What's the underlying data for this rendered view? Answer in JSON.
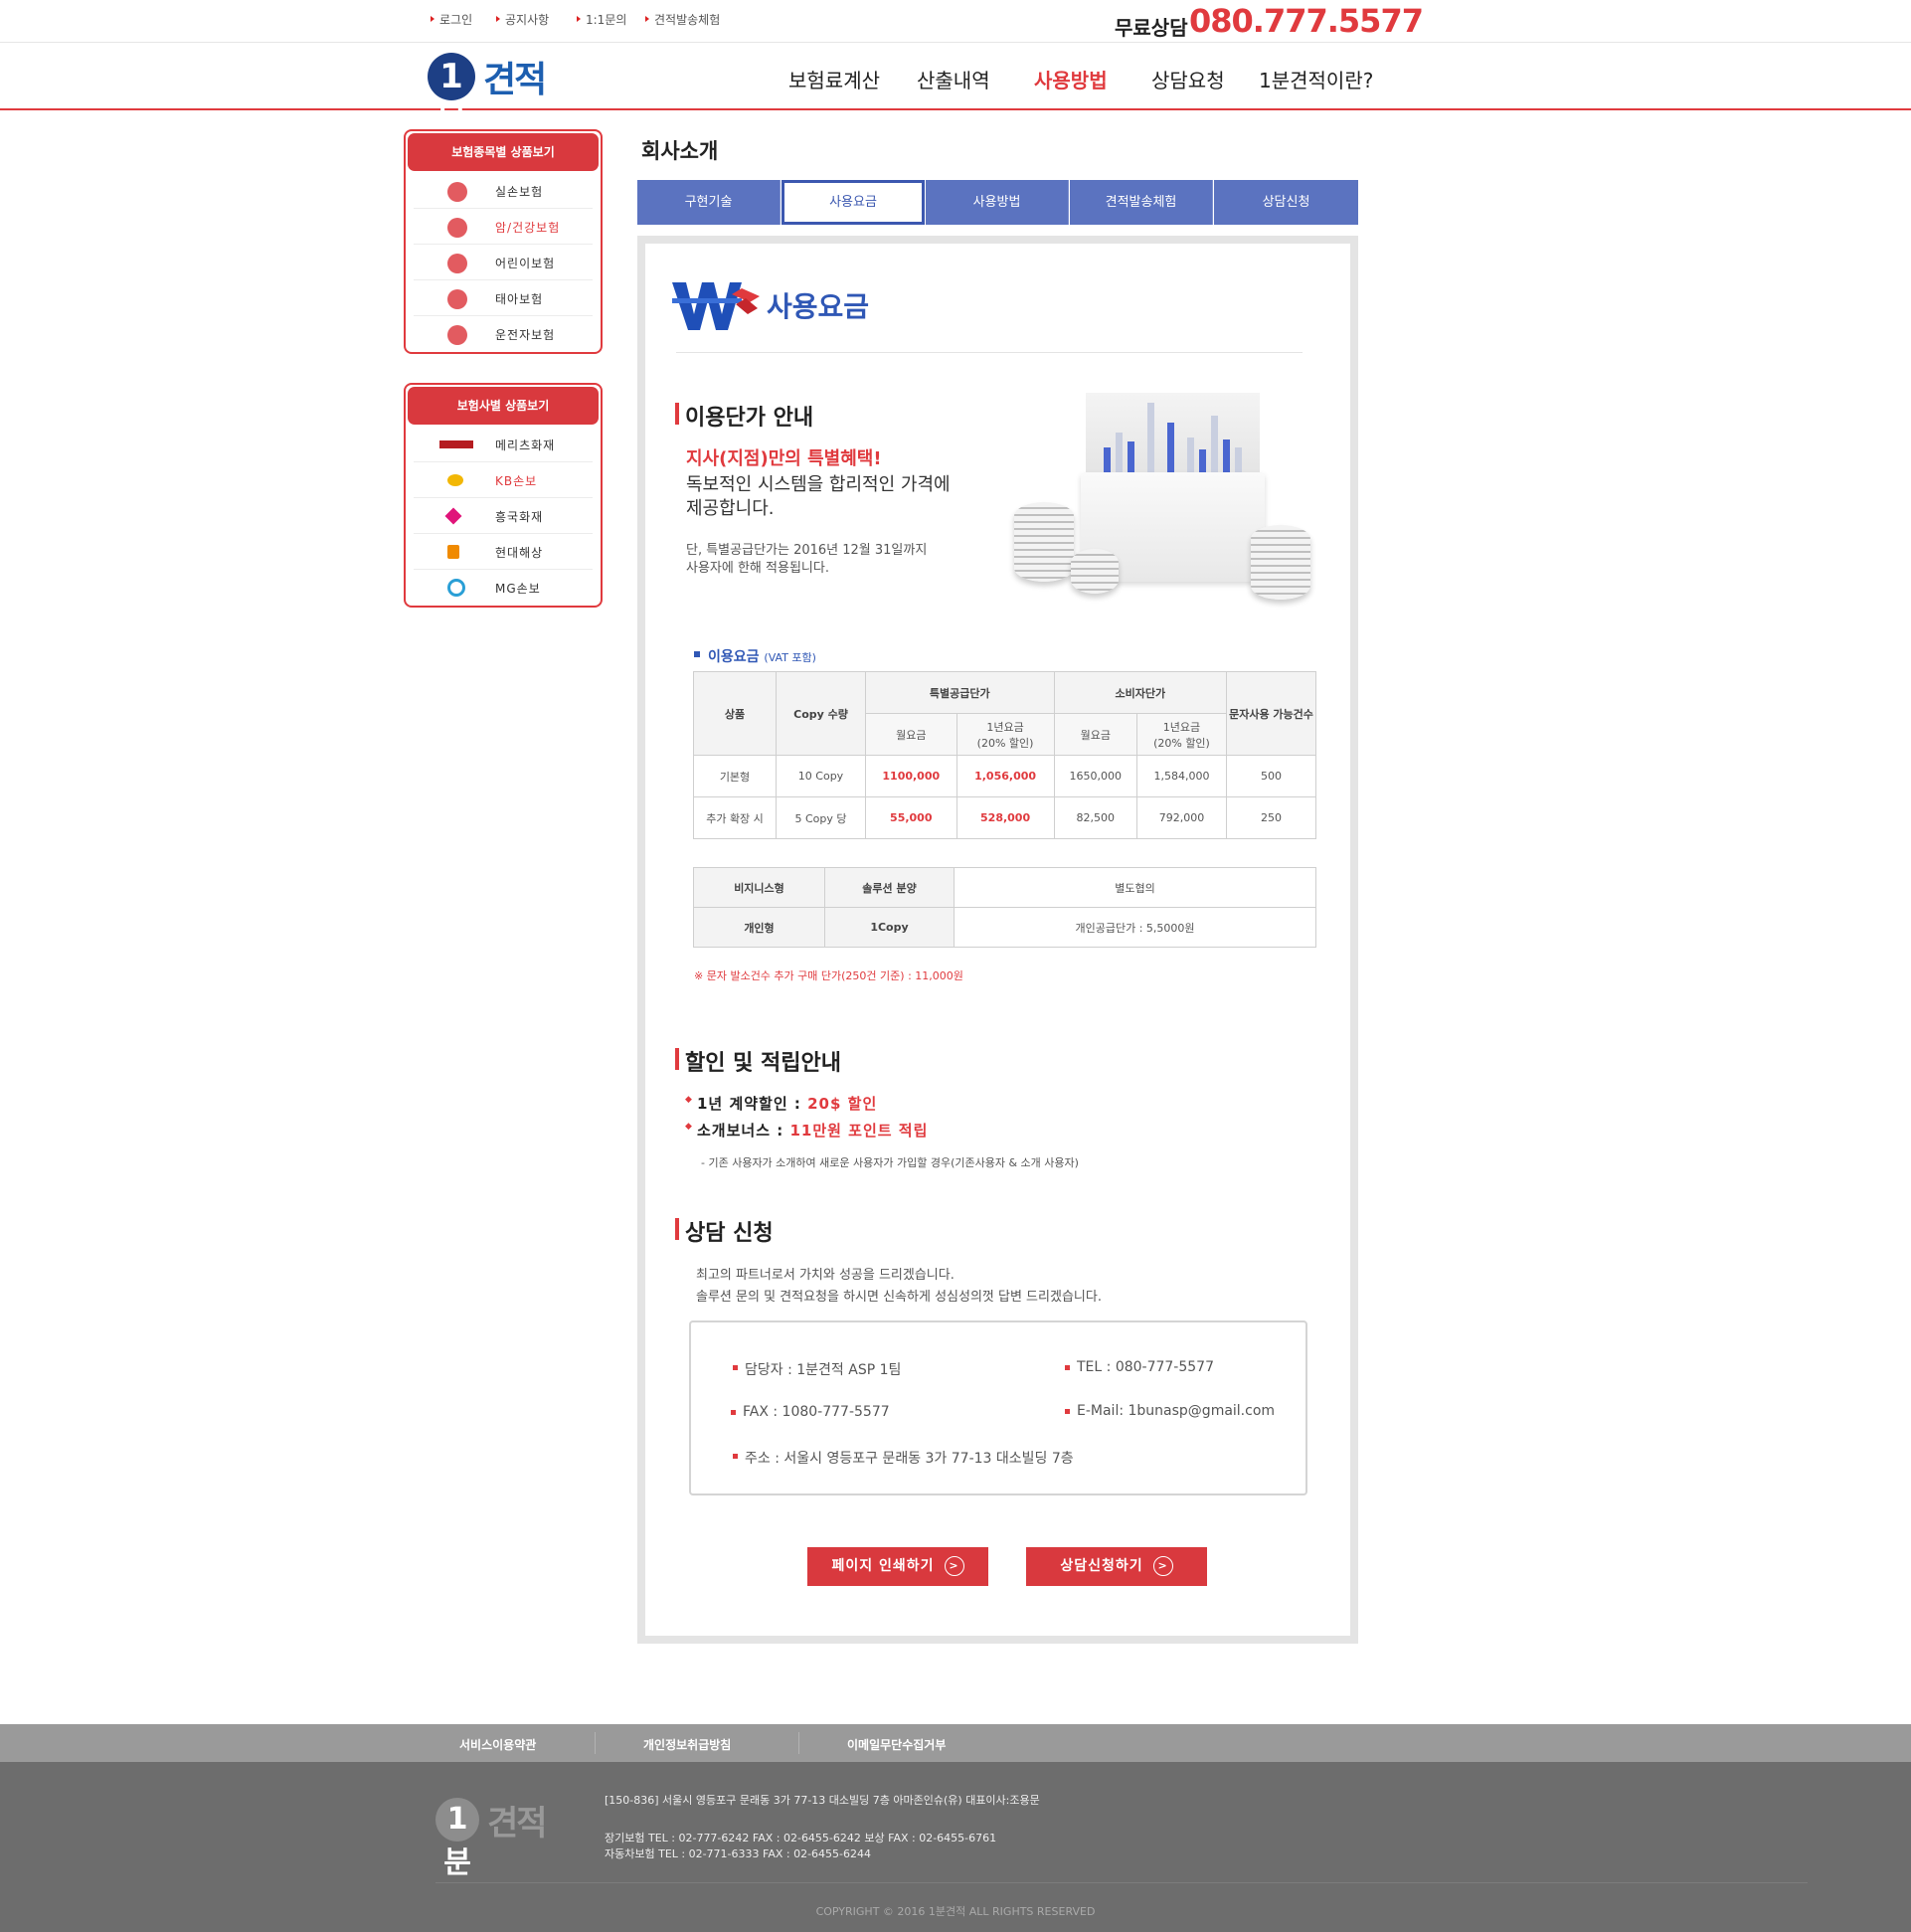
{
  "top_links": [
    "로그인",
    "공지사항",
    "1:1문의",
    "견적발송체험"
  ],
  "phone": {
    "label": "무료상담",
    "number": "080.777.5577"
  },
  "logo": {
    "one": "1분",
    "text": "견적"
  },
  "gnb": [
    "보험료계산",
    "산출내역",
    "사용방법",
    "상담요청",
    "1분견적이란?"
  ],
  "sidebar": {
    "box1": {
      "title": "보험종목별 상품보기",
      "items": [
        "실손보험",
        "암/건강보험",
        "어린이보험",
        "태아보험",
        "운전자보험"
      ]
    },
    "box2": {
      "title": "보험사별 상품보기",
      "items": [
        "메리츠화재",
        "KB손보",
        "흥국화재",
        "현대해상",
        "MG손보"
      ]
    }
  },
  "section_title": "회사소개",
  "tabs": [
    "구현기술",
    "사용요금",
    "사용방법",
    "견적발송체험",
    "상담신청"
  ],
  "page_heading": "사용요금",
  "pricing": {
    "title": "이용단가 안내",
    "promo_red": "지사(지점)만의 특별혜택!",
    "promo_1": "독보적인 시스템을 합리적인 가격에",
    "promo_2": "제공합니다.",
    "note_1": "단, 특별공급단가는 2016년 12월 31일까지",
    "note_2": "사용자에 한해 적용됩니다."
  },
  "fee_table": {
    "label": "이용요금",
    "label_sub": "(VAT 포함)",
    "headers": {
      "product": "상품",
      "copy": "Copy 수량",
      "special": "특별공급단가",
      "consumer": "소비자단가",
      "sms": "문자사용 가능건수",
      "monthly": "월요금",
      "yearly_1": "1년요금",
      "yearly_2": "(20% 할인)"
    },
    "rows": [
      {
        "product": "기본형",
        "copy": "10 Copy",
        "s_month": "1100,000",
        "s_year": "1,056,000",
        "c_month": "1650,000",
        "c_year": "1,584,000",
        "sms": "500"
      },
      {
        "product": "추가 확장 시",
        "copy": "5 Copy 당",
        "s_month": "55,000",
        "s_year": "528,000",
        "c_month": "82,500",
        "c_year": "792,000",
        "sms": "250"
      }
    ]
  },
  "biz_table": {
    "rows": [
      {
        "type": "비지니스형",
        "scope": "솔루션 분양",
        "price": "별도협의"
      },
      {
        "type": "개인형",
        "scope": "1Copy",
        "price": "개인공급단가 : 5,5000원"
      }
    ]
  },
  "sms_note": "※ 문자 발소건수 추가 구매 단가(250건 기준) : 11,000원",
  "discount": {
    "title": "할인 및 적립안내",
    "item1_label": "1년 계약할인 :",
    "item1_value": "20$ 할인",
    "item2_label": "소개보너스 :",
    "item2_value": "11만원 포인트 적립",
    "note": "- 기존 사용자가 소개하여 새로운 사용자가 가입할 경우(기존사용자 & 소개 사용자)"
  },
  "consult": {
    "title": "상담 신청",
    "line1": "최고의 파트너로서 가치와 성공을 드리겠습니다.",
    "line2": "솔루션 문의 및 견적요청을 하시면 신속하게 성심성의껏 답변 드리겠습니다.",
    "manager": "담당자 : 1분견적 ASP 1팀",
    "tel": "TEL : 080-777-5577",
    "fax": "FAX : 1080-777-5577",
    "email": "E-Mail: 1bunasp@gmail.com",
    "address": "주소 : 서울시 영등포구 문래동 3가 77-13 대소빌딩 7층"
  },
  "buttons": {
    "print": "페이지 인쇄하기",
    "request": "상담신청하기"
  },
  "footer": {
    "nav": [
      "서비스이용약관",
      "개인정보취급방침",
      "이메일무단수집거부"
    ],
    "address": "[150-836] 서울시 영등포구 문래동 3가 77-13 대소빌딩 7층 아마존인슈(유) 대표이사:조용문",
    "line2": "장기보험 TEL : 02-777-6242 FAX : 02-6455-6242 보상 FAX : 02-6455-6761",
    "line3": "자동차보험 TEL : 02-771-6333 FAX : 02-6455-6244",
    "copyright": "COPYRIGHT © 2016 1분견적 ALL RIGHTS RESERVED"
  },
  "colors": {
    "accent": "#e03a3e",
    "brand_blue": "#1d3f85",
    "tab_blue": "#5b73c0"
  }
}
